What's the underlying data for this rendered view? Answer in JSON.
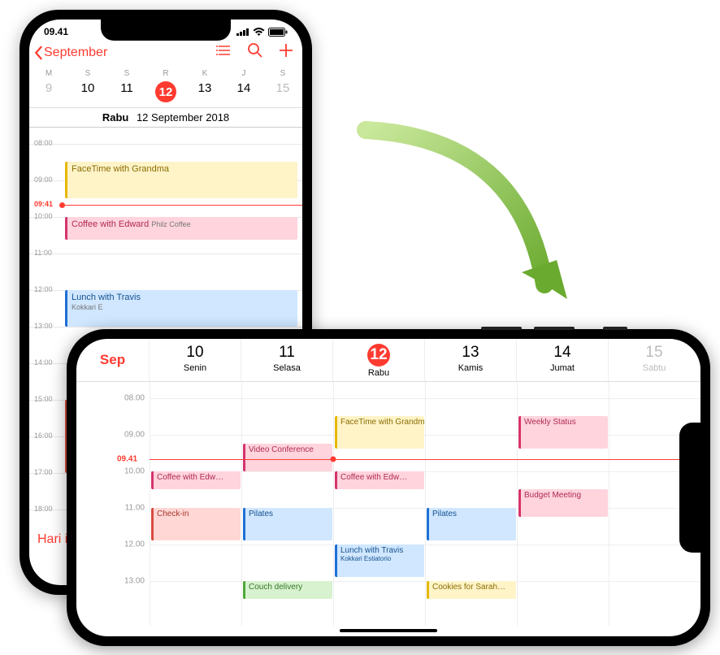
{
  "status_time": "09.41",
  "portrait": {
    "back_label": "September",
    "weekday_abbr": [
      "M",
      "S",
      "S",
      "R",
      "K",
      "J",
      "S"
    ],
    "day_numbers": [
      "9",
      "10",
      "11",
      "12",
      "13",
      "14",
      "15"
    ],
    "today_index": 3,
    "date_weekday": "Rabu",
    "date_full": "12 September 2018",
    "hours": [
      "08:00",
      "09:00",
      "10:00",
      "11:00",
      "12:00",
      "13:00",
      "14:00",
      "15:00",
      "16:00",
      "17:00",
      "18:00"
    ],
    "now_label": "09:41",
    "today_button": "Hari in",
    "events": {
      "e1": {
        "title": "FaceTime with Grandma"
      },
      "e2": {
        "title": "Coffee with Edward",
        "loc": "Philz Coffee"
      },
      "e3": {
        "title": "Lunch with Travis",
        "loc": "Kokkari E"
      }
    }
  },
  "landscape": {
    "month_abbr": "Sep",
    "columns": [
      {
        "num": "10",
        "name": "Senin"
      },
      {
        "num": "11",
        "name": "Selasa"
      },
      {
        "num": "12",
        "name": "Rabu"
      },
      {
        "num": "13",
        "name": "Kamis"
      },
      {
        "num": "14",
        "name": "Jumat"
      },
      {
        "num": "15",
        "name": "Sabtu"
      }
    ],
    "today_index": 2,
    "dim_index": 5,
    "hours": [
      "08.00",
      "09.00",
      "10.00",
      "11.00",
      "12.00",
      "13.00"
    ],
    "now_label": "09.41",
    "events": {
      "coffee1": "Coffee with Edw…",
      "checkin": "Check-in",
      "video": "Video Conference",
      "pilates1": "Pilates",
      "couch": "Couch delivery",
      "facetime": "FaceTime with Grandma",
      "coffee2": "Coffee with Edw…",
      "lunch_t": "Lunch with Travis",
      "lunch_loc": "Kokkari Estiatorio",
      "pilates2": "Pilates",
      "cookies": "Cookies for Sarah…",
      "weekly": "Weekly Status",
      "budget": "Budget Meeting"
    }
  }
}
